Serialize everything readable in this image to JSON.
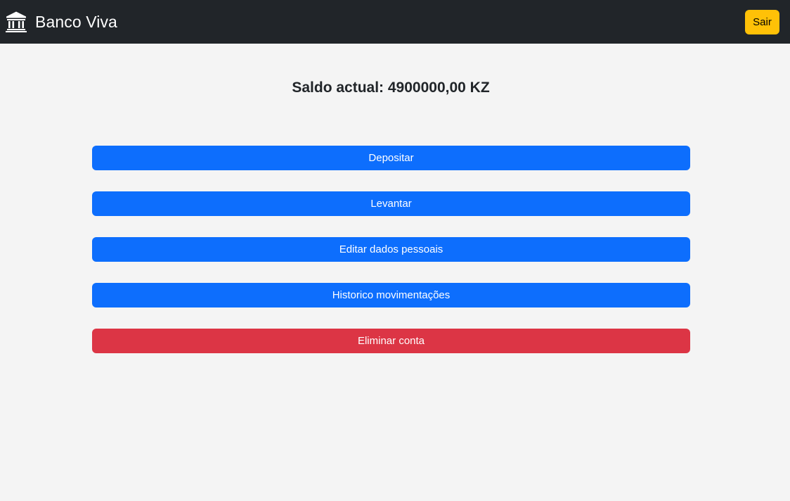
{
  "navbar": {
    "brand_name": "Banco Viva",
    "brand_icon": "bank-icon",
    "logout_label": "Sair"
  },
  "balance": {
    "text": "Saldo actual: 4900000,00 KZ"
  },
  "actions": {
    "deposit_label": "Depositar",
    "withdraw_label": "Levantar",
    "edit_profile_label": "Editar dados pessoais",
    "history_label": "Historico movimentações",
    "delete_account_label": "Eliminar conta"
  },
  "colors": {
    "navbar_bg": "#212529",
    "page_bg": "#f4f4f4",
    "primary": "#0d6efd",
    "danger": "#dc3545",
    "warning": "#ffc107"
  }
}
